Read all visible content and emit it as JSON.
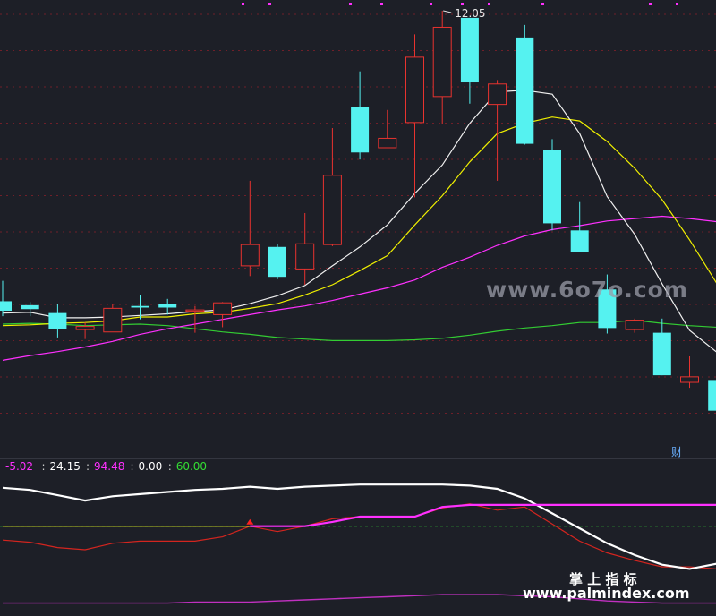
{
  "chart_data": [
    {
      "type": "candlestick",
      "peak_label": "12.05",
      "corner_label": "财",
      "colors": {
        "up": "#e8332f",
        "down": "#55f2f0",
        "ma5": "#f0f0f0",
        "ma10": "#f0f000",
        "ma20": "#ff30ff",
        "ma60": "#33cc33",
        "grid": "#7a1f2a"
      },
      "candles": [
        {
          "o": 8.36,
          "h": 8.62,
          "l": 8.17,
          "c": 8.24
        },
        {
          "o": 8.31,
          "h": 8.35,
          "l": 8.17,
          "c": 8.26
        },
        {
          "o": 8.21,
          "h": 8.33,
          "l": 7.9,
          "c": 8.01
        },
        {
          "o": 8.0,
          "h": 8.09,
          "l": 7.88,
          "c": 8.04
        },
        {
          "o": 7.97,
          "h": 8.33,
          "l": 7.97,
          "c": 8.27
        },
        {
          "o": 8.3,
          "h": 8.44,
          "l": 8.13,
          "c": 8.28
        },
        {
          "o": 8.33,
          "h": 8.39,
          "l": 8.19,
          "c": 8.28
        },
        {
          "o": 8.24,
          "h": 8.3,
          "l": 7.96,
          "c": 8.25
        },
        {
          "o": 8.19,
          "h": 8.35,
          "l": 8.03,
          "c": 8.34
        },
        {
          "o": 8.81,
          "h": 9.89,
          "l": 8.68,
          "c": 9.08
        },
        {
          "o": 9.05,
          "h": 9.09,
          "l": 8.64,
          "c": 8.67
        },
        {
          "o": 8.77,
          "h": 9.48,
          "l": 8.57,
          "c": 9.09
        },
        {
          "o": 9.08,
          "h": 10.56,
          "l": 9.06,
          "c": 9.96
        },
        {
          "o": 10.83,
          "h": 11.28,
          "l": 10.16,
          "c": 10.25
        },
        {
          "o": 10.31,
          "h": 10.79,
          "l": 10.31,
          "c": 10.43
        },
        {
          "o": 10.63,
          "h": 11.75,
          "l": 9.68,
          "c": 11.46
        },
        {
          "o": 10.96,
          "h": 12.05,
          "l": 10.61,
          "c": 11.84
        },
        {
          "o": 11.96,
          "h": 11.87,
          "l": 10.87,
          "c": 11.14
        },
        {
          "o": 10.86,
          "h": 11.17,
          "l": 9.89,
          "c": 11.12
        },
        {
          "o": 11.71,
          "h": 11.87,
          "l": 10.35,
          "c": 10.36
        },
        {
          "o": 10.28,
          "h": 10.42,
          "l": 9.26,
          "c": 9.35
        },
        {
          "o": 9.26,
          "h": 9.62,
          "l": 8.99,
          "c": 8.98
        },
        {
          "o": 8.51,
          "h": 8.7,
          "l": 7.95,
          "c": 8.02
        },
        {
          "o": 8.0,
          "h": 8.14,
          "l": 7.96,
          "c": 8.12
        },
        {
          "o": 7.96,
          "h": 8.14,
          "l": 7.43,
          "c": 7.42
        },
        {
          "o": 7.33,
          "h": 7.66,
          "l": 7.26,
          "c": 7.4
        },
        {
          "o": 7.36,
          "h": 7.53,
          "l": 6.93,
          "c": 6.97
        }
      ],
      "ma5": [
        8.21,
        8.22,
        8.15,
        8.15,
        8.16,
        8.18,
        8.2,
        8.23,
        8.25,
        8.33,
        8.43,
        8.56,
        8.81,
        9.05,
        9.33,
        9.73,
        10.09,
        10.62,
        11.02,
        11.04,
        10.99,
        10.49,
        9.69,
        9.21,
        8.58,
        7.99,
        7.71
      ],
      "ma10": [
        8.05,
        8.06,
        8.08,
        8.09,
        8.11,
        8.16,
        8.16,
        8.2,
        8.22,
        8.27,
        8.33,
        8.44,
        8.57,
        8.75,
        8.94,
        9.33,
        9.7,
        10.13,
        10.49,
        10.62,
        10.7,
        10.65,
        10.39,
        10.05,
        9.65,
        9.14,
        8.58
      ],
      "ma20": [
        7.61,
        7.67,
        7.72,
        7.78,
        7.85,
        7.94,
        8.01,
        8.07,
        8.13,
        8.19,
        8.25,
        8.3,
        8.37,
        8.45,
        8.53,
        8.63,
        8.79,
        8.92,
        9.07,
        9.19,
        9.27,
        9.32,
        9.38,
        9.41,
        9.44,
        9.41,
        9.37
      ],
      "ma60": [
        8.07,
        8.08,
        8.07,
        8.05,
        8.06,
        8.07,
        8.05,
        8.01,
        7.97,
        7.94,
        7.9,
        7.88,
        7.86,
        7.86,
        7.86,
        7.87,
        7.89,
        7.93,
        7.98,
        8.02,
        8.05,
        8.09,
        8.09,
        8.12,
        8.08,
        8.05,
        8.03
      ]
    },
    {
      "type": "line",
      "values_text": [
        "-5.02",
        "24.15",
        "94.48",
        "0.00",
        "60.00"
      ],
      "colors": {
        "white": "#ffffff",
        "magenta": "#ff30ff",
        "red": "#d4251f",
        "yellow": "#e8f020",
        "green_dash": "#33cc33",
        "bottom": "#c030c0"
      },
      "series": [
        {
          "values": [
            96,
            94,
            89,
            84,
            88,
            90,
            92,
            94,
            95,
            97,
            95,
            97,
            98,
            99,
            99,
            99,
            99,
            98,
            95,
            86,
            72,
            58,
            44,
            33,
            24,
            20,
            25
          ]
        },
        {
          "values": [
            null,
            null,
            null,
            null,
            null,
            null,
            null,
            null,
            null,
            60,
            60,
            60,
            64,
            69,
            69,
            69,
            78,
            80,
            80,
            80,
            80,
            80,
            80,
            80,
            80,
            80,
            80
          ]
        },
        {
          "values": [
            47,
            45,
            40,
            38,
            44,
            46,
            46,
            46,
            50,
            60,
            55,
            60,
            67,
            69,
            69,
            69,
            77,
            81,
            75,
            78,
            62,
            46,
            35,
            28,
            22,
            22,
            20
          ]
        },
        {
          "values": [
            60,
            60,
            60,
            60,
            60,
            60,
            60,
            60,
            60,
            60,
            60,
            60,
            null,
            null,
            null,
            null,
            null,
            null,
            null,
            null,
            null,
            null,
            null,
            null,
            null,
            null,
            null
          ]
        },
        {
          "values": [
            60,
            60,
            60,
            60,
            60,
            60,
            60,
            60,
            60,
            60,
            60,
            60,
            60,
            60,
            60,
            60,
            60,
            60,
            60,
            60,
            60,
            60,
            60,
            60,
            60,
            60,
            60
          ]
        },
        {
          "values": [
            -12,
            -12,
            -12,
            -12,
            -12,
            -12,
            -12,
            -11,
            -11,
            -11,
            -10,
            -9,
            -8,
            -7,
            -6,
            -5,
            -4,
            -4,
            -4,
            -5,
            -6,
            -8,
            -10,
            -11,
            -12,
            -12,
            -12
          ]
        }
      ]
    }
  ],
  "watermarks": {
    "mid": "www.6o7o.com",
    "bottom_cn": "掌 上 指 标",
    "bottom_url": "www.palmindex.com"
  }
}
